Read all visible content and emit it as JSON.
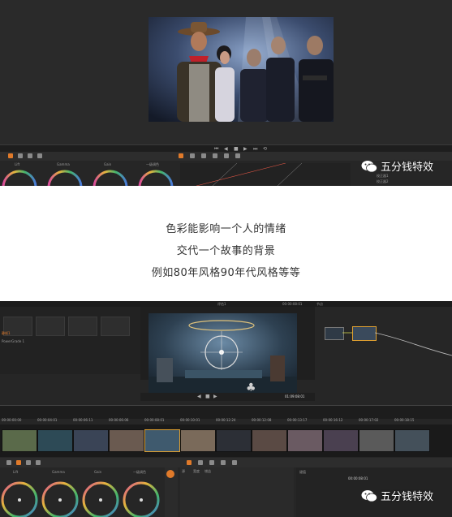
{
  "caption": {
    "line1": "色彩能影响一个人的情绪",
    "line2": "交代一个故事的背景",
    "line3": "例如80年风格90年代风格等等"
  },
  "watermark": {
    "text": "五分钱特效",
    "icon": "wechat-icon"
  },
  "shot1": {
    "wheel_labels": [
      "Lift",
      "Gamma",
      "Gain",
      "一级调色"
    ],
    "node_labels": [
      "校正器1",
      "校正器2"
    ]
  },
  "shot2": {
    "viewer_title": "评估1",
    "viewer_timecode": "00:00:08:01",
    "nodes_title": "节点",
    "still_label": "静帧1",
    "still_sub": "PowerGrade 1",
    "transport_timecode": "01:09:08:01",
    "clip_timecodes": [
      "00:00:00:00",
      "00:00:04:01",
      "00:00:06:11",
      "00:00:06:06",
      "00:00:08:01",
      "00:00:10:01",
      "00:00:12:24",
      "00:00:12:08",
      "00:00:13:17",
      "00:00:16:12",
      "00:00:17:02",
      "00:00:18:15"
    ],
    "wheel_labels": [
      "Lift",
      "Gamma",
      "Gain",
      "一级调色"
    ],
    "info_label": "键值",
    "info_timecode": "00:00:08:01",
    "side_labels": [
      "源",
      "宽度",
      "增益"
    ]
  },
  "colors": {
    "accent_orange": "#e07a2a",
    "panel_dark": "#262626",
    "wheel_ring": "rainbow"
  }
}
